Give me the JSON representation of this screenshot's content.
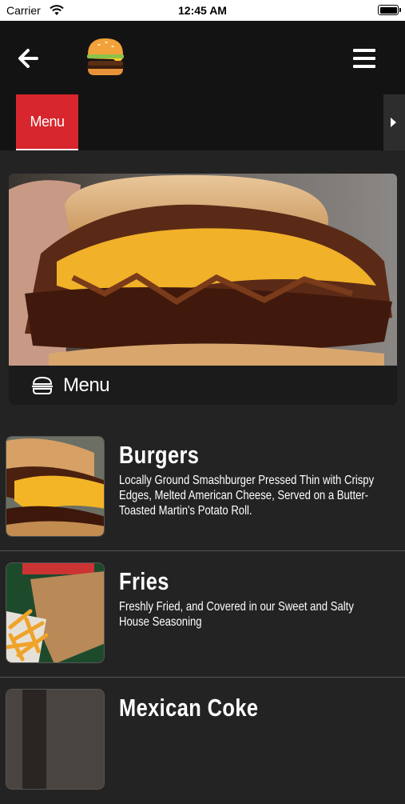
{
  "status_bar": {
    "carrier": "Carrier",
    "time": "12:45 AM"
  },
  "nav": {
    "back_icon": "arrow-left-icon",
    "logo_icon": "burger-logo-icon",
    "menu_icon": "hamburger-menu-icon"
  },
  "tabs": [
    {
      "label": "Menu",
      "active": true
    }
  ],
  "hero": {
    "label": "Menu",
    "icon": "burger-icon"
  },
  "menu_items": [
    {
      "title": "Burgers",
      "description": "Locally Ground Smashburger Pressed Thin with Crispy Edges, Melted American Cheese, Served on a Butter-Toasted Martin's Potato Roll."
    },
    {
      "title": "Fries",
      "description": "Freshly Fried, and Covered in our Sweet and Salty House Seasoning"
    },
    {
      "title": "Mexican Coke",
      "description": ""
    }
  ],
  "colors": {
    "accent": "#d7262d",
    "background": "#232323",
    "nav": "#131313"
  }
}
